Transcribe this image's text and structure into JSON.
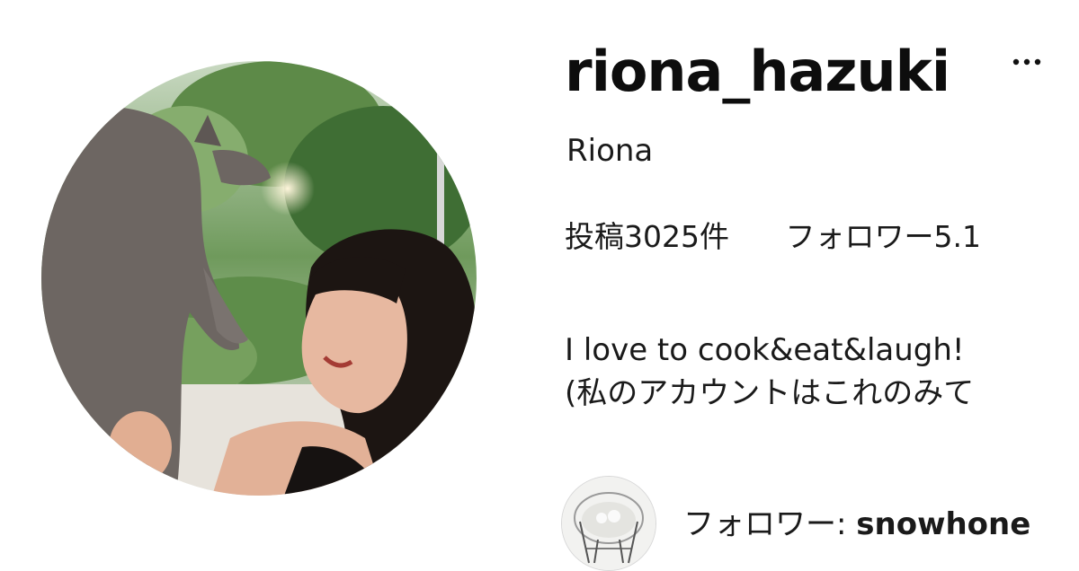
{
  "profile": {
    "username": "riona_hazuki",
    "full_name": "Riona",
    "more_icon": "ellipsis-icon",
    "stats": {
      "posts": "投稿3025件",
      "followers": "フォロワー5.1"
    },
    "bio": {
      "line1": "I love to cook&eat&laugh!",
      "line2": "(私のアカウントはこれのみて"
    },
    "followed_by": {
      "prefix": "フォロワー: ",
      "user": "snowhone"
    }
  },
  "colors": {
    "text": "#111111",
    "background": "#ffffff"
  }
}
